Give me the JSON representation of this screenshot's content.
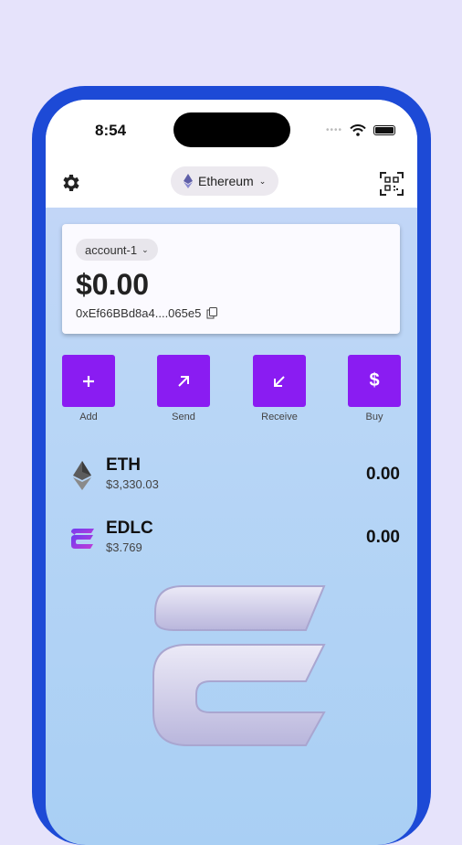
{
  "status": {
    "time": "8:54"
  },
  "header": {
    "network_label": "Ethereum",
    "settings_icon": "gear-icon",
    "qr_icon": "qr-scan-icon"
  },
  "account": {
    "name": "account-1",
    "balance": "$0.00",
    "address": "0xEf66BBd8a4....065e5"
  },
  "actions": [
    {
      "label": "Add",
      "icon": "plus-icon"
    },
    {
      "label": "Send",
      "icon": "arrow-up-right-icon"
    },
    {
      "label": "Receive",
      "icon": "arrow-down-left-icon"
    },
    {
      "label": "Buy",
      "icon": "dollar-icon"
    }
  ],
  "tokens": [
    {
      "symbol": "ETH",
      "price": "$3,330.03",
      "balance": "0.00",
      "icon": "ethereum-icon"
    },
    {
      "symbol": "EDLC",
      "price": "$3.769",
      "balance": "0.00",
      "icon": "edlc-logo-icon"
    }
  ],
  "colors": {
    "frame": "#1d4ad6",
    "accent": "#8a1cf2"
  }
}
